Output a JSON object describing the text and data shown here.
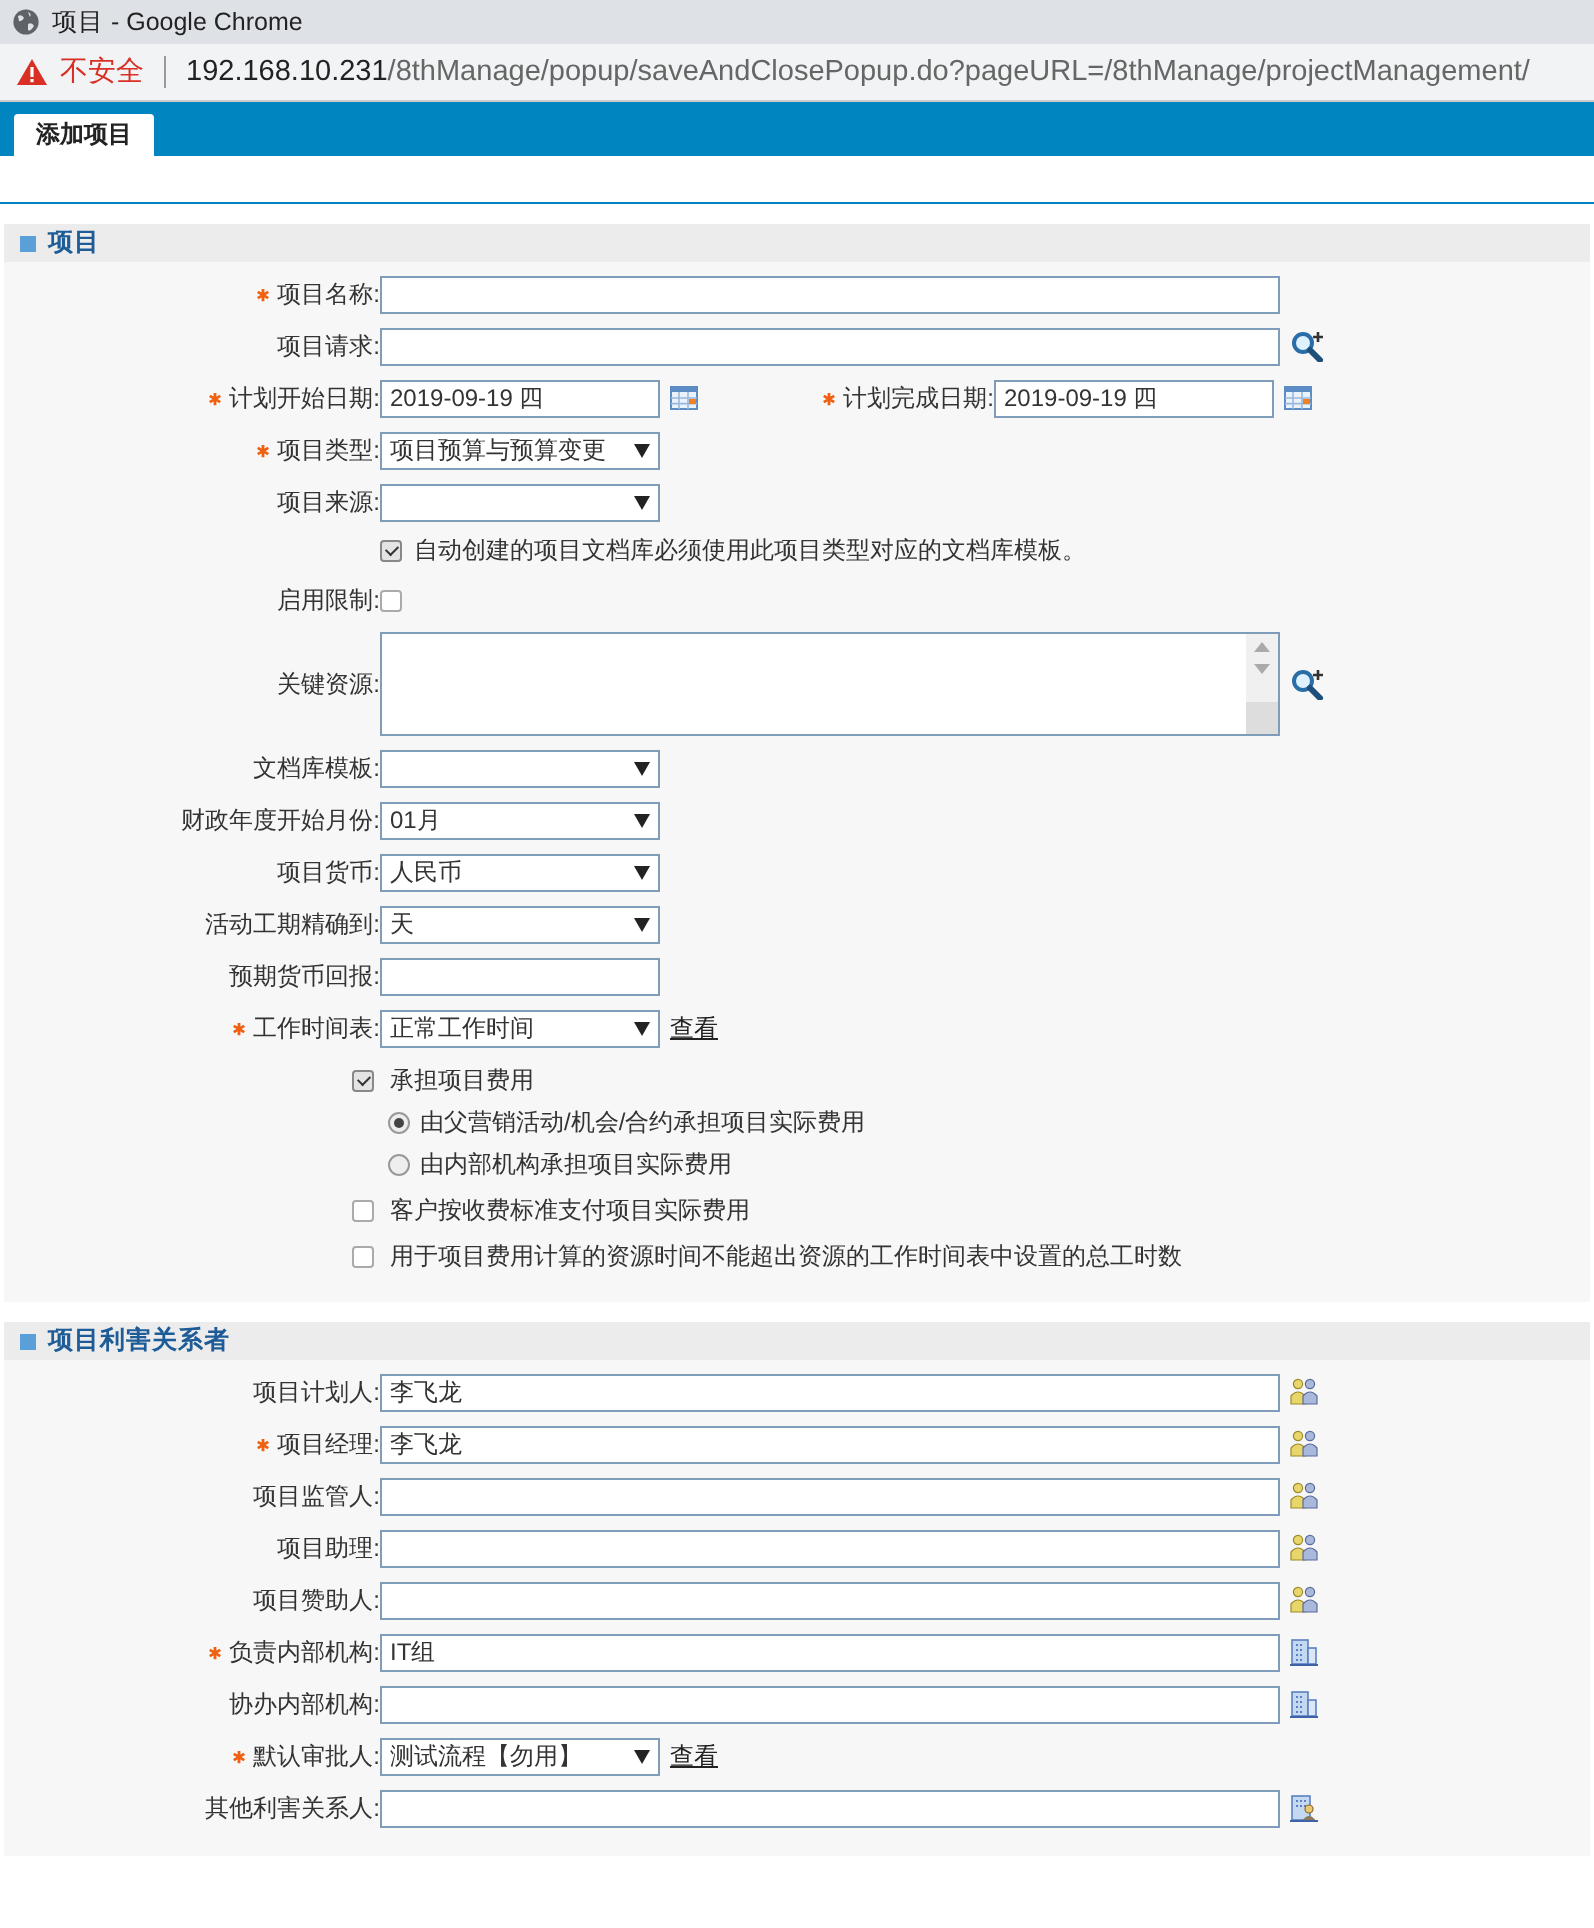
{
  "window": {
    "title": "项目 - Google Chrome"
  },
  "address_bar": {
    "security": "不安全",
    "url_host": "192.168.10.231",
    "url_path": "/8thManage/popup/saveAndClosePopup.do?pageURL=/8thManage/projectManagement/"
  },
  "tabs": [
    {
      "label": "添加项目",
      "selected": true
    }
  ],
  "sections": [
    {
      "title": "项目",
      "rows": [
        {
          "kind": "text",
          "label": "项目名称:",
          "required": true,
          "value": ""
        },
        {
          "kind": "lookup",
          "label": "项目请求:",
          "required": false,
          "value": ""
        },
        {
          "kind": "date-pair",
          "fields": [
            {
              "label": "计划开始日期:",
              "required": true,
              "value": "2019-09-19 四"
            },
            {
              "label": "计划完成日期:",
              "required": true,
              "value": "2019-09-19 四"
            }
          ]
        },
        {
          "kind": "select",
          "label": "项目类型:",
          "required": true,
          "value": "项目预算与预算变更"
        },
        {
          "kind": "select",
          "label": "项目来源:",
          "required": false,
          "value": ""
        },
        {
          "kind": "note-checkbox",
          "text": "自动创建的项目文档库必须使用此项目类型对应的文档库模板。",
          "checked": true
        },
        {
          "kind": "checkbox",
          "label": "启用限制:",
          "checked": false
        },
        {
          "kind": "textarea",
          "label": "关键资源:",
          "value": ""
        },
        {
          "kind": "select",
          "label": "文档库模板:",
          "required": false,
          "value": ""
        },
        {
          "kind": "select",
          "label": "财政年度开始月份:",
          "required": false,
          "value": "01月"
        },
        {
          "kind": "select",
          "label": "项目货币:",
          "required": false,
          "value": "人民币"
        },
        {
          "kind": "select",
          "label": "活动工期精确到:",
          "required": false,
          "value": "天"
        },
        {
          "kind": "short-text",
          "label": "预期货币回报:",
          "required": false,
          "value": ""
        },
        {
          "kind": "select",
          "label": "工作时间表:",
          "required": true,
          "value": "正常工作时间",
          "link": "查看"
        }
      ],
      "options": [
        {
          "kind": "checkbox",
          "label": "承担项目费用",
          "checked": true,
          "children": [
            {
              "kind": "radio",
              "label": "由父营销活动/机会/合约承担项目实际费用",
              "selected": true
            },
            {
              "kind": "radio",
              "label": "由内部机构承担项目实际费用",
              "selected": false
            }
          ]
        },
        {
          "kind": "checkbox",
          "label": "客户按收费标准支付项目实际费用",
          "checked": false
        },
        {
          "kind": "checkbox",
          "label": "用于项目费用计算的资源时间不能超出资源的工作时间表中设置的总工时数",
          "checked": false
        }
      ]
    },
    {
      "title": "项目利害关系者",
      "rows": [
        {
          "kind": "person-picker",
          "label": "项目计划人:",
          "required": false,
          "value": "李飞龙"
        },
        {
          "kind": "person-picker",
          "label": "项目经理:",
          "required": true,
          "value": "李飞龙"
        },
        {
          "kind": "person-picker",
          "label": "项目监管人:",
          "required": false,
          "value": ""
        },
        {
          "kind": "person-picker",
          "label": "项目助理:",
          "required": false,
          "value": ""
        },
        {
          "kind": "person-picker",
          "label": "项目赞助人:",
          "required": false,
          "value": ""
        },
        {
          "kind": "org-picker",
          "label": "负责内部机构:",
          "required": true,
          "value": "IT组"
        },
        {
          "kind": "org-picker",
          "label": "协办内部机构:",
          "required": false,
          "value": ""
        },
        {
          "kind": "select",
          "label": "默认审批人:",
          "required": true,
          "value": "测试流程【勿用】",
          "link": "查看"
        },
        {
          "kind": "contact-picker",
          "label": "其他利害关系人:",
          "required": false,
          "value": ""
        }
      ]
    }
  ]
}
